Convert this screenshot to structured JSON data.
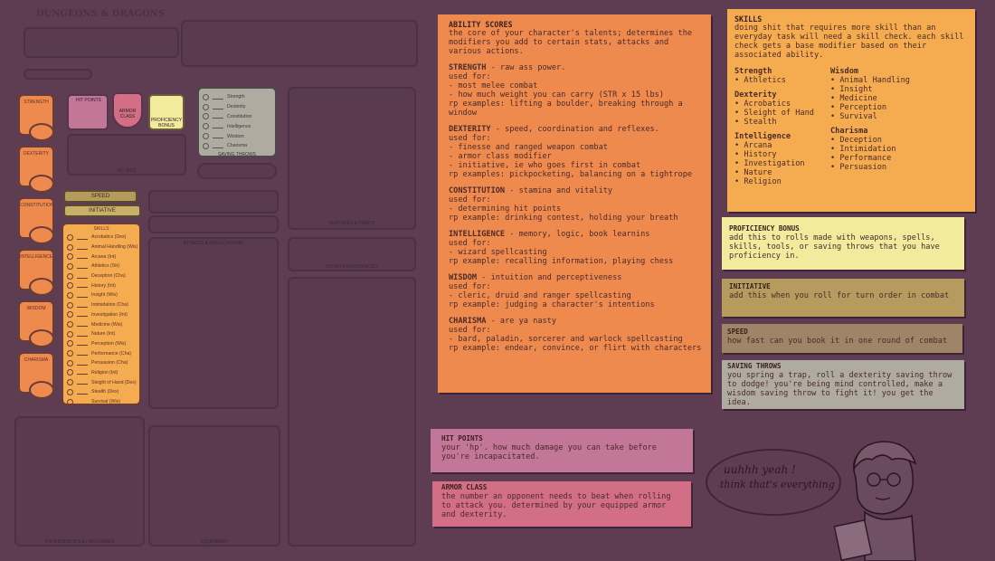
{
  "sheet": {
    "logo_text": "DUNGEONS & DRAGONS",
    "header_labels": [
      "CHARACTER NAME",
      "BACKGROUND",
      "RACE",
      "XP",
      "ALIGNMENT",
      "CLASS & LEVEL"
    ],
    "abilities": [
      "STRENGTH",
      "DEXTERITY",
      "CONSTITUTION",
      "INTELLIGENCE",
      "WISDOM",
      "CHARISMA"
    ],
    "hit_points": "HIT POINTS",
    "armor_class": "ARMOR CLASS",
    "proficiency_bonus": "PROFICIENCY BONUS",
    "speed": "SPEED",
    "initiative": "INITIATIVE",
    "skills_title": "SKILLS",
    "skills": [
      "Acrobatics (Dex)",
      "Animal Handling (Wis)",
      "Arcana (Int)",
      "Athletics (Str)",
      "Deception (Cha)",
      "History (Int)",
      "Insight (Wis)",
      "Intimidation (Cha)",
      "Investigation (Int)",
      "Medicine (Wis)",
      "Nature (Int)",
      "Perception (Wis)",
      "Performance (Cha)",
      "Persuasion (Cha)",
      "Religion (Int)",
      "Sleight of Hand (Dex)",
      "Stealth (Dex)",
      "Survival (Wis)"
    ],
    "saving_throws_title": "SAVING THROWS",
    "saves": [
      "Strength",
      "Dexterity",
      "Constitution",
      "Intelligence",
      "Wisdom",
      "Charisma"
    ],
    "section_labels": {
      "hit_dice": "HIT DICE",
      "attacks": "ATTACKS & SPELLCASTING",
      "equipment": "EQUIPMENT",
      "proficiencies": "PROFICIENCIES & LANGUAGES",
      "features": "FEATURES & TRAITS",
      "other": "OTHER PROFICIENCIES"
    }
  },
  "notes": {
    "abilities": {
      "title": "ABILITY SCORES",
      "intro": "the core of your character's talents; determines the modifiers you add to certain stats, attacks and various actions.",
      "items": [
        {
          "name": "STRENGTH",
          "text": " - raw ass power.\nused for:\n- most melee combat\n- how much weight you can carry (STR x 15 lbs)\nrp examples: lifting a boulder, breaking through a window"
        },
        {
          "name": "DEXTERITY",
          "text": " - speed, coordination and reflexes.\nused for:\n- finesse and ranged weapon combat\n- armor class modifier\n- initiative, ie who goes first in combat\nrp examples: pickpocketing, balancing on a tightrope"
        },
        {
          "name": "CONSTITUTION",
          "text": " - stamina and vitality\nused for:\n- determining hit points\nrp example: drinking contest, holding your breath"
        },
        {
          "name": "INTELLIGENCE",
          "text": " - memory, logic, book learnins\nused for:\n- wizard spellcasting\nrp example: recalling information, playing chess"
        },
        {
          "name": "WISDOM",
          "text": " - intuition and perceptiveness\nused for:\n- cleric, druid and ranger spellcasting\nrp example: judging a character's intentions"
        },
        {
          "name": "CHARISMA",
          "text": " - are ya nasty\nused for:\n- bard, paladin, sorcerer and warlock spellcasting\nrp example: endear, convince, or flirt with characters"
        }
      ]
    },
    "skills": {
      "title": "SKILLS",
      "intro": "doing shit that requires more skill than an everyday task will need a skill check. each skill check gets a base modifier based on their associated ability.",
      "col1": [
        {
          "name": "Strength",
          "items": [
            "• Athletics"
          ]
        },
        {
          "name": "Dexterity",
          "items": [
            "• Acrobatics",
            "• Sleight of Hand",
            "• Stealth"
          ]
        },
        {
          "name": "Intelligence",
          "items": [
            "• Arcana",
            "• History",
            "• Investigation",
            "• Nature",
            "• Religion"
          ]
        }
      ],
      "col2": [
        {
          "name": "Wisdom",
          "items": [
            "• Animal Handling",
            "• Insight",
            "• Medicine",
            "• Perception",
            "• Survival"
          ]
        },
        {
          "name": "Charisma",
          "items": [
            "• Deception",
            "• Intimidation",
            "• Performance",
            "• Persuasion"
          ]
        }
      ]
    },
    "proficiency": {
      "title": "PROFICIENCY BONUS",
      "text": "add this to rolls made with weapons, spells, skills, tools, or saving throws that you have proficiency in."
    },
    "initiative": {
      "title": "INITIATIVE",
      "text": "add this when you roll for turn order in combat"
    },
    "speed": {
      "title": "SPEED",
      "text": "how fast can you book it in one round of combat"
    },
    "saving_throws": {
      "title": "SAVING THROWS",
      "text": "you spring a trap, roll a dexterity saving throw to dodge! you're being mind controlled, make a wisdom saving throw to fight it! you get the idea."
    },
    "hit_points": {
      "title": "HIT POINTS",
      "text": "your 'hp'. how much damage you can take before you're incapacitated."
    },
    "armor_class": {
      "title": "ARMOR CLASS",
      "text": "the number an opponent needs to beat when rolling to attack you. determined by your equipped armor and dexterity."
    }
  },
  "speech": {
    "line1": "uuhhh yeah !",
    "line2": "think that's everything"
  },
  "colors": {
    "orange": "#ef8a4f",
    "amber": "#f5ac50",
    "pale_yellow": "#f2ea9c",
    "olive": "#b69b5f",
    "tan": "#a08467",
    "grey": "#b0aba1",
    "pink": "#c27698",
    "rose": "#d26e86",
    "background": "#5e3d52"
  }
}
